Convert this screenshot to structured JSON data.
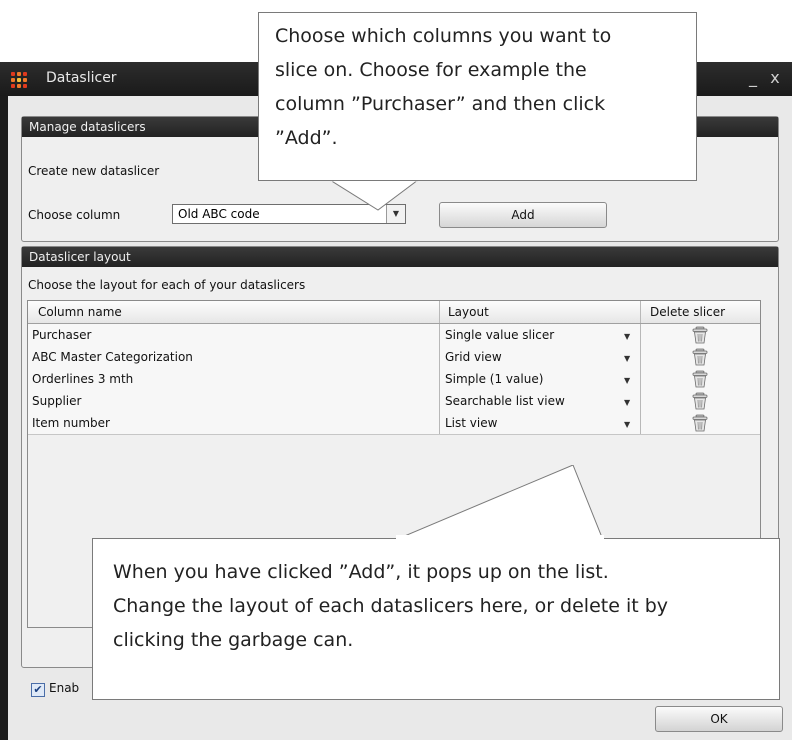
{
  "window": {
    "title": "Dataslicer",
    "minimize_glyph": "_",
    "close_glyph": "x",
    "app_icon": "grid-dots-icon",
    "icon_colors": [
      "#e03a1e",
      "#f07a2a",
      "#e03a1e",
      "#f07a2a",
      "#f5c23a",
      "#f07a2a",
      "#e03a1e",
      "#f07a2a",
      "#e03a1e"
    ]
  },
  "manage": {
    "header": "Manage dataslicers",
    "create_label": "Create new dataslicer",
    "choose_column_label": "Choose column",
    "column_value": "Old ABC code",
    "add_label": "Add"
  },
  "layout": {
    "header": "Dataslicer layout",
    "intro": "Choose the layout for each of your dataslicers",
    "columns": [
      "Column name",
      "Layout",
      "Delete slicer"
    ],
    "rows": [
      {
        "name": "Purchaser",
        "layout": "Single value slicer"
      },
      {
        "name": "ABC Master Categorization",
        "layout": "Grid view"
      },
      {
        "name": "Orderlines 3 mth",
        "layout": "Simple (1 value)"
      },
      {
        "name": "Supplier",
        "layout": "Searchable list view"
      },
      {
        "name": "Item number",
        "layout": "List view"
      }
    ],
    "enable_label": "Enab",
    "enable_checked": true
  },
  "footer": {
    "ok_label": "OK"
  },
  "callouts": {
    "top": [
      "Choose which columns you want to",
      "slice on. Choose for example the",
      "column ”Purchaser” and then click",
      "”Add”."
    ],
    "bottom": [
      "When you have clicked ”Add”, it pops up on the list.",
      "Change the layout of each dataslicers here, or delete it by",
      "clicking the garbage can."
    ]
  }
}
